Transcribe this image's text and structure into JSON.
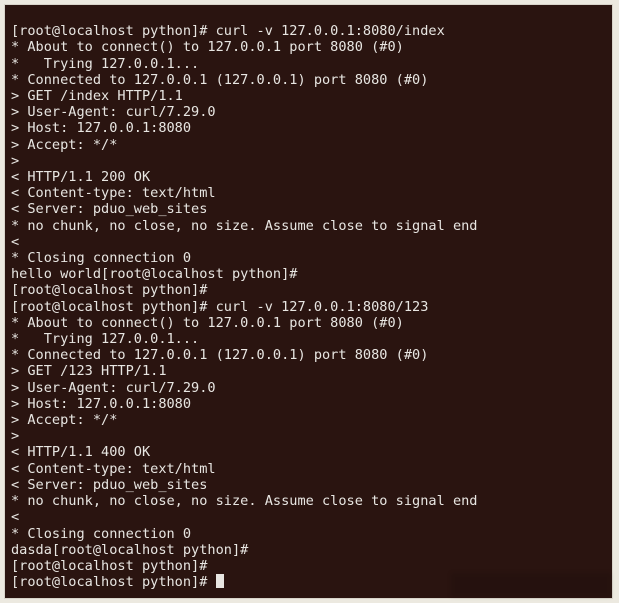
{
  "prompt": {
    "user": "root",
    "host": "localhost",
    "dir": "python",
    "text": "[root@localhost python]# "
  },
  "session1": {
    "cmd": "curl -v 127.0.0.1:8080/index",
    "l1": "* About to connect() to 127.0.0.1 port 8080 (#0)",
    "l2": "*   Trying 127.0.0.1...",
    "l3": "* Connected to 127.0.0.1 (127.0.0.1) port 8080 (#0)",
    "l4": "> GET /index HTTP/1.1",
    "l5": "> User-Agent: curl/7.29.0",
    "l6": "> Host: 127.0.0.1:8080",
    "l7": "> Accept: */*",
    "l8": ">",
    "l9": "< HTTP/1.1 200 OK",
    "l10": "< Content-type: text/html",
    "l11": "< Server: pduo_web_sites",
    "l12": "* no chunk, no close, no size. Assume close to signal end",
    "l13": "<",
    "l14": "* Closing connection 0",
    "body": "hello world"
  },
  "session2": {
    "cmd": "curl -v 127.0.0.1:8080/123",
    "l1": "* About to connect() to 127.0.0.1 port 8080 (#0)",
    "l2": "*   Trying 127.0.0.1...",
    "l3": "* Connected to 127.0.0.1 (127.0.0.1) port 8080 (#0)",
    "l4": "> GET /123 HTTP/1.1",
    "l5": "> User-Agent: curl/7.29.0",
    "l6": "> Host: 127.0.0.1:8080",
    "l7": "> Accept: */*",
    "l8": ">",
    "l9": "< HTTP/1.1 400 OK",
    "l10": "< Content-type: text/html",
    "l11": "< Server: pduo_web_sites",
    "l12": "* no chunk, no close, no size. Assume close to signal end",
    "l13": "<",
    "l14": "* Closing connection 0",
    "body": "dasda"
  }
}
